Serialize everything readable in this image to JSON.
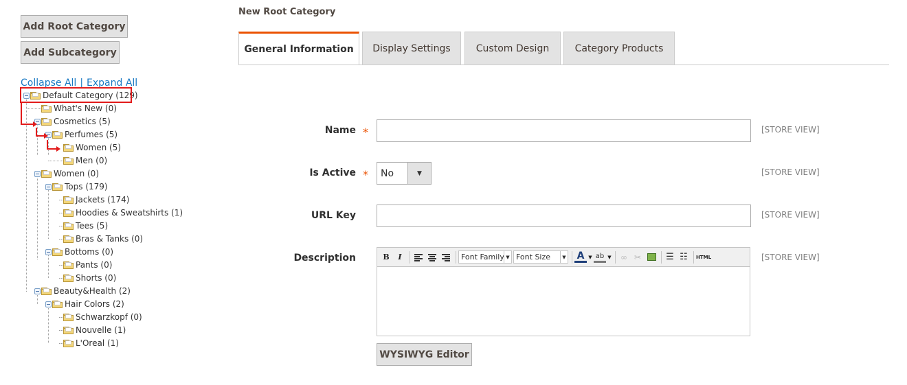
{
  "sidebar": {
    "add_root_label": "Add Root Category",
    "add_sub_label": "Add Subcategory",
    "collapse_all": "Collapse All",
    "separator": "|",
    "expand_all": "Expand All",
    "tree": [
      {
        "label": "Default Category (129)"
      },
      {
        "label": "What's New (0)"
      },
      {
        "label": "Cosmetics (5)"
      },
      {
        "label": "Perfumes (5)"
      },
      {
        "label": "Women (5)"
      },
      {
        "label": "Men (0)"
      },
      {
        "label": "Women (0)"
      },
      {
        "label": "Tops (179)"
      },
      {
        "label": "Jackets (174)"
      },
      {
        "label": "Hoodies & Sweatshirts (1)"
      },
      {
        "label": "Tees (5)"
      },
      {
        "label": "Bras & Tanks (0)"
      },
      {
        "label": "Bottoms (0)"
      },
      {
        "label": "Pants (0)"
      },
      {
        "label": "Shorts (0)"
      },
      {
        "label": "Beauty&Health (2)"
      },
      {
        "label": "Hair Colors (2)"
      },
      {
        "label": "Schwarzkopf (0)"
      },
      {
        "label": "Nouvelle (1)"
      },
      {
        "label": "L'Oreal (1)"
      }
    ],
    "highlight_color": "#e21b1b"
  },
  "main": {
    "page_title": "New Root Category",
    "tabs": [
      {
        "label": "General Information",
        "active": true
      },
      {
        "label": "Display Settings"
      },
      {
        "label": "Custom Design"
      },
      {
        "label": "Category Products"
      }
    ],
    "accent_color": "#eb5202",
    "form": {
      "name_label": "Name",
      "name_value": "",
      "is_active_label": "Is Active",
      "is_active_value": "No",
      "url_key_label": "URL Key",
      "url_key_value": "",
      "description_label": "Description",
      "required_mark": "*",
      "scope": "[STORE VIEW]",
      "editor": {
        "bold": "B",
        "italic": "I",
        "font_family": "Font Family",
        "font_size": "Font Size",
        "html": "HTML"
      },
      "wysiwyg_label": "WYSIWYG Editor"
    }
  }
}
